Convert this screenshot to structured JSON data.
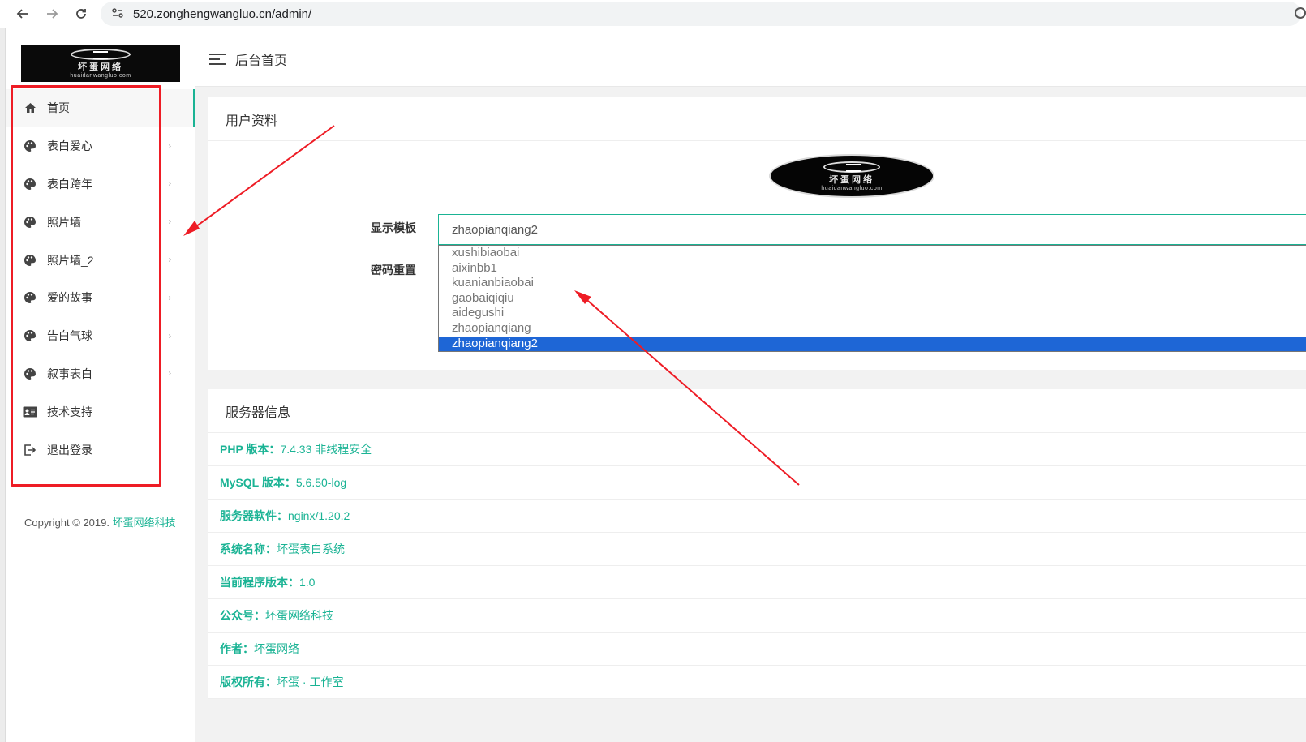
{
  "browser": {
    "url": "520.zonghengwangluo.cn/admin/",
    "back_icon": "arrow-left-icon",
    "forward_icon": "arrow-right-icon",
    "reload_icon": "reload-icon"
  },
  "logo": {
    "cn": "坏蛋网络",
    "en": "huaidanwangluo.com"
  },
  "sidebar": {
    "items": [
      {
        "label": "首页",
        "icon": "home-icon",
        "has_arrow": false,
        "active": true
      },
      {
        "label": "表白爱心",
        "icon": "palette-icon",
        "has_arrow": true
      },
      {
        "label": "表白跨年",
        "icon": "palette-icon",
        "has_arrow": true
      },
      {
        "label": "照片墙",
        "icon": "palette-icon",
        "has_arrow": true
      },
      {
        "label": "照片墙_2",
        "icon": "palette-icon",
        "has_arrow": true
      },
      {
        "label": "爱的故事",
        "icon": "palette-icon",
        "has_arrow": true
      },
      {
        "label": "告白气球",
        "icon": "palette-icon",
        "has_arrow": true
      },
      {
        "label": "叙事表白",
        "icon": "palette-icon",
        "has_arrow": true
      },
      {
        "label": "技术支持",
        "icon": "id-card-icon",
        "has_arrow": false
      },
      {
        "label": "退出登录",
        "icon": "logout-icon",
        "has_arrow": false
      }
    ],
    "arrow_glyph": "›",
    "copyright_prefix": "Copyright © 2019. ",
    "copyright_link": "坏蛋网络科技"
  },
  "header": {
    "title": "后台首页"
  },
  "profile_card": {
    "title": "用户资料",
    "template_label": "显示模板",
    "password_label": "密码重置",
    "selected_template": "zhaopianqiang2",
    "options": [
      "xushibiaobai",
      "aixinbb1",
      "kuanianbiaobai",
      "gaobaiqiqiu",
      "aidegushi",
      "zhaopianqiang",
      "zhaopianqiang2"
    ]
  },
  "server_card": {
    "title": "服务器信息",
    "rows": [
      {
        "label": "PHP 版本：",
        "value": "7.4.33 非线程安全"
      },
      {
        "label": "MySQL 版本：",
        "value": "5.6.50-log"
      },
      {
        "label": "服务器软件：",
        "value": "nginx/1.20.2"
      },
      {
        "label": "系统名称：",
        "value": "坏蛋表白系统"
      },
      {
        "label": "当前程序版本：",
        "value": "1.0"
      },
      {
        "label": "公众号：",
        "value": "坏蛋网络科技"
      },
      {
        "label": "作者：",
        "value": "坏蛋网络"
      },
      {
        "label": "版权所有：",
        "value": "坏蛋 · 工作室"
      }
    ]
  },
  "colors": {
    "accent": "#1ab394",
    "selected_option": "#1e66d6",
    "annotation": "#ee1c25"
  }
}
